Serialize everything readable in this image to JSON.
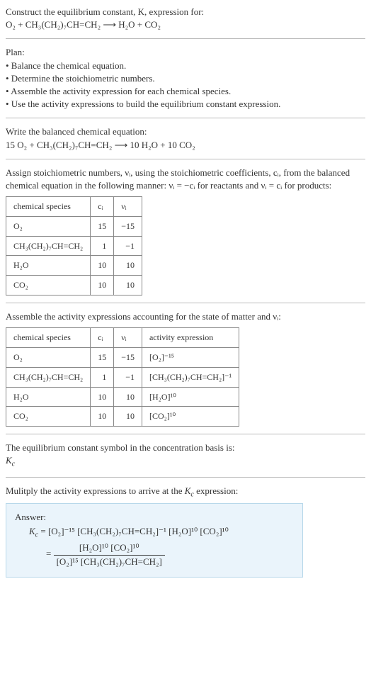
{
  "intro": {
    "line1": "Construct the equilibrium constant, K, expression for:",
    "eq": "O₂ + CH₃(CH₂)₇CH=CH₂  ⟶  H₂O + CO₂"
  },
  "plan": {
    "heading": "Plan:",
    "items": [
      "• Balance the chemical equation.",
      "• Determine the stoichiometric numbers.",
      "• Assemble the activity expression for each chemical species.",
      "• Use the activity expressions to build the equilibrium constant expression."
    ]
  },
  "balanced": {
    "heading": "Write the balanced chemical equation:",
    "eq": "15 O₂ + CH₃(CH₂)₇CH=CH₂  ⟶  10 H₂O + 10 CO₂"
  },
  "stoich": {
    "text_a": "Assign stoichiometric numbers, νᵢ, using the stoichiometric coefficients, cᵢ, from the balanced chemical equation in the following manner: νᵢ = −cᵢ for reactants and νᵢ = cᵢ for products:",
    "headers": {
      "species": "chemical species",
      "c": "cᵢ",
      "v": "νᵢ"
    },
    "rows": [
      {
        "species": "O₂",
        "c": "15",
        "v": "−15"
      },
      {
        "species": "CH₃(CH₂)₇CH=CH₂",
        "c": "1",
        "v": "−1"
      },
      {
        "species": "H₂O",
        "c": "10",
        "v": "10"
      },
      {
        "species": "CO₂",
        "c": "10",
        "v": "10"
      }
    ]
  },
  "activity": {
    "text": "Assemble the activity expressions accounting for the state of matter and νᵢ:",
    "headers": {
      "species": "chemical species",
      "c": "cᵢ",
      "v": "νᵢ",
      "act": "activity expression"
    },
    "rows": [
      {
        "species": "O₂",
        "c": "15",
        "v": "−15",
        "act": "[O₂]⁻¹⁵"
      },
      {
        "species": "CH₃(CH₂)₇CH=CH₂",
        "c": "1",
        "v": "−1",
        "act": "[CH₃(CH₂)₇CH=CH₂]⁻¹"
      },
      {
        "species": "H₂O",
        "c": "10",
        "v": "10",
        "act": "[H₂O]¹⁰"
      },
      {
        "species": "CO₂",
        "c": "10",
        "v": "10",
        "act": "[CO₂]¹⁰"
      }
    ]
  },
  "symbol": {
    "text": "The equilibrium constant symbol in the concentration basis is:",
    "sym": "K_c"
  },
  "multiply": {
    "text": "Mulitply the activity expressions to arrive at the K_c expression:"
  },
  "answer": {
    "label": "Answer:",
    "line1_lhs": "K_c = ",
    "line1_rhs": "[O₂]⁻¹⁵ [CH₃(CH₂)₇CH=CH₂]⁻¹ [H₂O]¹⁰ [CO₂]¹⁰",
    "eq_prefix": "= ",
    "frac_num": "[H₂O]¹⁰ [CO₂]¹⁰",
    "frac_den": "[O₂]¹⁵ [CH₃(CH₂)₇CH=CH₂]"
  },
  "chart_data": {
    "type": "table",
    "tables": [
      {
        "title": "Stoichiometric numbers",
        "columns": [
          "chemical species",
          "cᵢ",
          "νᵢ"
        ],
        "rows": [
          [
            "O₂",
            15,
            -15
          ],
          [
            "CH₃(CH₂)₇CH=CH₂",
            1,
            -1
          ],
          [
            "H₂O",
            10,
            10
          ],
          [
            "CO₂",
            10,
            10
          ]
        ]
      },
      {
        "title": "Activity expressions",
        "columns": [
          "chemical species",
          "cᵢ",
          "νᵢ",
          "activity expression"
        ],
        "rows": [
          [
            "O₂",
            15,
            -15,
            "[O₂]^-15"
          ],
          [
            "CH₃(CH₂)₇CH=CH₂",
            1,
            -1,
            "[CH₃(CH₂)₇CH=CH₂]^-1"
          ],
          [
            "H₂O",
            10,
            10,
            "[H₂O]^10"
          ],
          [
            "CO₂",
            10,
            10,
            "[CO₂]^10"
          ]
        ]
      }
    ]
  }
}
